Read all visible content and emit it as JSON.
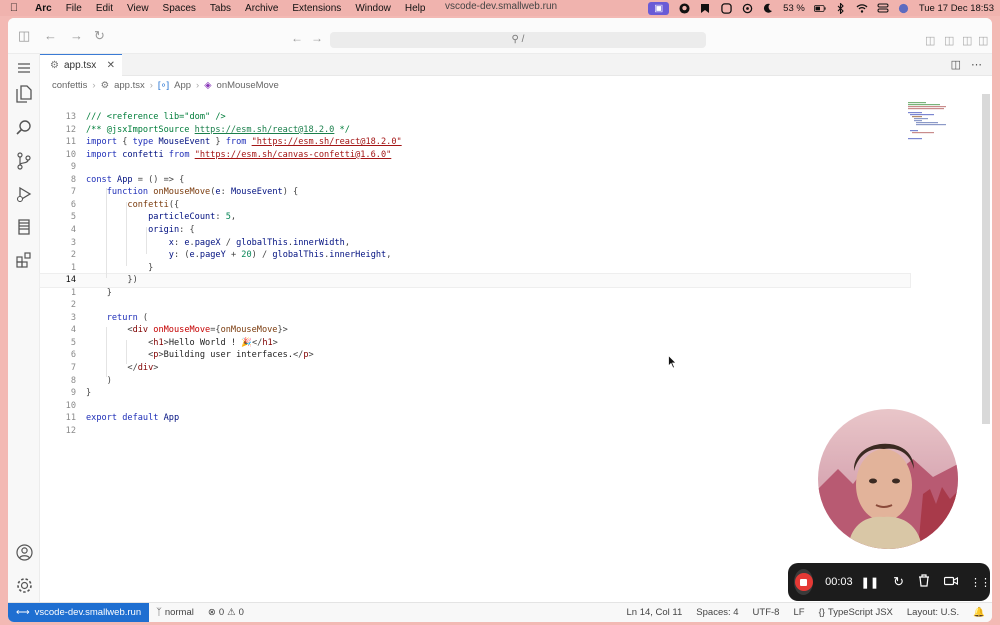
{
  "menubar": {
    "app": "Arc",
    "items": [
      "File",
      "Edit",
      "View",
      "Spaces",
      "Tabs",
      "Archive",
      "Extensions",
      "Window",
      "Help"
    ],
    "center_url": "vscode-dev.smallweb.run",
    "battery": "53 %",
    "datetime": "Tue 17 Dec  18:53"
  },
  "browser": {
    "address": "/"
  },
  "tab": {
    "label": "app.tsx"
  },
  "breadcrumb": [
    "confettis",
    "app.tsx",
    "App",
    "onMouseMove"
  ],
  "editor": {
    "current_line": "14",
    "lines": [
      {
        "n": "13",
        "tokens": [
          [
            "com",
            "/// <reference lib=\"dom\" />"
          ]
        ]
      },
      {
        "n": "12",
        "tokens": [
          [
            "com",
            "/** @jsxImportSource "
          ],
          [
            "lnk",
            "https://esm.sh/react@18.2.0"
          ],
          [
            "com",
            " */"
          ]
        ]
      },
      {
        "n": "11",
        "tokens": [
          [
            "kw",
            "import"
          ],
          [
            "punc",
            " { "
          ],
          [
            "kw",
            "type"
          ],
          [
            "prop",
            " MouseEvent"
          ],
          [
            "punc",
            " } "
          ],
          [
            "kw",
            "from"
          ],
          [
            "punc",
            " "
          ],
          [
            "str",
            "\"https://esm.sh/react@18.2.0\""
          ]
        ]
      },
      {
        "n": "10",
        "tokens": [
          [
            "kw",
            "import"
          ],
          [
            "prop",
            " confetti"
          ],
          [
            "kw",
            " from"
          ],
          [
            "punc",
            " "
          ],
          [
            "str",
            "\"https://esm.sh/canvas-confetti@1.6.0\""
          ]
        ]
      },
      {
        "n": "9",
        "tokens": []
      },
      {
        "n": "8",
        "tokens": [
          [
            "kw",
            "const"
          ],
          [
            "prop",
            " App"
          ],
          [
            "punc",
            " = () => {"
          ]
        ]
      },
      {
        "n": "7",
        "tokens": [
          [
            "punc",
            "    "
          ],
          [
            "kw",
            "function"
          ],
          [
            "fn",
            " onMouseMove"
          ],
          [
            "punc",
            "("
          ],
          [
            "prop",
            "e"
          ],
          [
            "punc",
            ": "
          ],
          [
            "prop",
            "MouseEvent"
          ],
          [
            "punc",
            ") {"
          ]
        ]
      },
      {
        "n": "6",
        "tokens": [
          [
            "punc",
            "        "
          ],
          [
            "fn",
            "confetti"
          ],
          [
            "punc",
            "({"
          ]
        ]
      },
      {
        "n": "5",
        "tokens": [
          [
            "punc",
            "            "
          ],
          [
            "prop",
            "particleCount"
          ],
          [
            "punc",
            ": "
          ],
          [
            "num",
            "5"
          ],
          [
            "punc",
            ","
          ]
        ]
      },
      {
        "n": "4",
        "tokens": [
          [
            "punc",
            "            "
          ],
          [
            "prop",
            "origin"
          ],
          [
            "punc",
            ": {"
          ]
        ]
      },
      {
        "n": "3",
        "tokens": [
          [
            "punc",
            "                "
          ],
          [
            "prop",
            "x"
          ],
          [
            "punc",
            ": "
          ],
          [
            "prop",
            "e"
          ],
          [
            "punc",
            "."
          ],
          [
            "prop",
            "pageX"
          ],
          [
            "punc",
            " / "
          ],
          [
            "prop",
            "globalThis"
          ],
          [
            "punc",
            "."
          ],
          [
            "prop",
            "innerWidth"
          ],
          [
            "punc",
            ","
          ]
        ]
      },
      {
        "n": "2",
        "tokens": [
          [
            "punc",
            "                "
          ],
          [
            "prop",
            "y"
          ],
          [
            "punc",
            ": ("
          ],
          [
            "prop",
            "e"
          ],
          [
            "punc",
            "."
          ],
          [
            "prop",
            "pageY"
          ],
          [
            "punc",
            " + "
          ],
          [
            "num",
            "20"
          ],
          [
            "punc",
            ") / "
          ],
          [
            "prop",
            "globalThis"
          ],
          [
            "punc",
            "."
          ],
          [
            "prop",
            "innerHeight"
          ],
          [
            "punc",
            ","
          ]
        ]
      },
      {
        "n": "1",
        "tokens": [
          [
            "punc",
            "            }"
          ]
        ]
      },
      {
        "n": "14",
        "tokens": [
          [
            "punc",
            "        })"
          ]
        ]
      },
      {
        "n": "1",
        "tokens": [
          [
            "punc",
            "    }"
          ]
        ]
      },
      {
        "n": "2",
        "tokens": []
      },
      {
        "n": "3",
        "tokens": [
          [
            "punc",
            "    "
          ],
          [
            "kw",
            "return"
          ],
          [
            "punc",
            " ("
          ]
        ]
      },
      {
        "n": "4",
        "tokens": [
          [
            "punc",
            "        <"
          ],
          [
            "tag",
            "div"
          ],
          [
            "attr",
            " onMouseMove"
          ],
          [
            "punc",
            "={"
          ],
          [
            "fn",
            "onMouseMove"
          ],
          [
            "punc",
            "}>"
          ]
        ]
      },
      {
        "n": "5",
        "tokens": [
          [
            "punc",
            "            <"
          ],
          [
            "tag",
            "h1"
          ],
          [
            "punc",
            ">"
          ],
          [
            "txt",
            "Hello World ! 🎉"
          ],
          [
            "punc",
            "</"
          ],
          [
            "tag",
            "h1"
          ],
          [
            "punc",
            ">"
          ]
        ]
      },
      {
        "n": "6",
        "tokens": [
          [
            "punc",
            "            <"
          ],
          [
            "tag",
            "p"
          ],
          [
            "punc",
            ">"
          ],
          [
            "txt",
            "Building user interfaces."
          ],
          [
            "punc",
            "</"
          ],
          [
            "tag",
            "p"
          ],
          [
            "punc",
            ">"
          ]
        ]
      },
      {
        "n": "7",
        "tokens": [
          [
            "punc",
            "        </"
          ],
          [
            "tag",
            "div"
          ],
          [
            "punc",
            ">"
          ]
        ]
      },
      {
        "n": "8",
        "tokens": [
          [
            "punc",
            "    )"
          ]
        ]
      },
      {
        "n": "9",
        "tokens": [
          [
            "punc",
            "}"
          ]
        ]
      },
      {
        "n": "10",
        "tokens": []
      },
      {
        "n": "11",
        "tokens": [
          [
            "kw",
            "export"
          ],
          [
            "kw",
            " default"
          ],
          [
            "prop",
            " App"
          ]
        ]
      },
      {
        "n": "12",
        "tokens": []
      }
    ]
  },
  "statusbar": {
    "remote": "vscode-dev.smallweb.run",
    "mode": "normal",
    "problems": "0",
    "warnings": "0",
    "position": "Ln 14, Col 11",
    "spaces": "Spaces: 4",
    "encoding": "UTF-8",
    "eol": "LF",
    "language": "TypeScript JSX",
    "layout": "Layout: U.S."
  },
  "recorder": {
    "time": "00:03"
  },
  "colors": {
    "accent": "#1f6fd1",
    "record": "#e53935",
    "menubar": "#f0b3ae"
  }
}
